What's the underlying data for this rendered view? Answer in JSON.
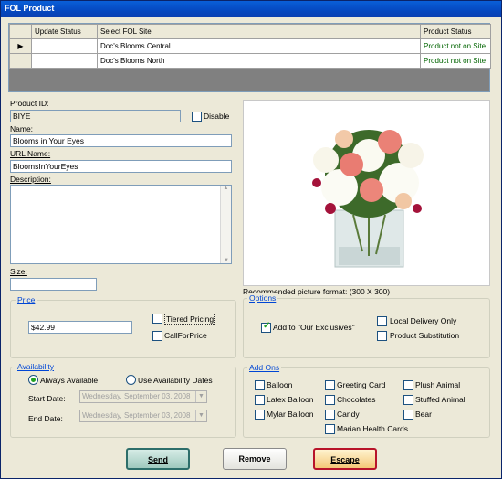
{
  "window": {
    "title": "FOL Product"
  },
  "grid": {
    "columns": [
      "Update Status",
      "Select FOL Site",
      "Product Status"
    ],
    "rows": [
      {
        "indicator": "▶",
        "update_status": "",
        "site": "Doc's Blooms Central",
        "status": "Product not on Site"
      },
      {
        "indicator": "",
        "update_status": "",
        "site": "Doc's Blooms North",
        "status": "Product not on Site"
      }
    ]
  },
  "form": {
    "product_id_label": "Product ID:",
    "product_id_value": "BIYE",
    "disable_label": "Disable",
    "name_label": "Name:",
    "name_value": "Blooms in Your Eyes",
    "url_label": "URL Name:",
    "url_value": "BloomsInYourEyes",
    "description_label": "Description:",
    "description_value": "",
    "size_label": "Size:",
    "size_value": "",
    "picture_note": "Recommended picture format: (300 X 300)"
  },
  "price": {
    "title": "Price",
    "value": "$42.99",
    "tiered_label": "Tiered Pricing",
    "callforprice_label": "CallForPrice"
  },
  "options": {
    "title": "Options",
    "exclusives_label": "Add to \"Our Exclusives\"",
    "local_delivery_label": "Local Delivery Only",
    "substitution_label": "Product Substitution"
  },
  "availability": {
    "title": "Availability",
    "always_label": "Always Available",
    "dates_label": "Use Availability Dates",
    "start_label": "Start Date:",
    "start_value": "Wednesday, September 03, 2008",
    "end_label": "End Date:",
    "end_value": "Wednesday, September 03, 2008"
  },
  "addons": {
    "title": "Add Ons",
    "items": [
      "Balloon",
      "Greeting Card",
      "Plush Animal",
      "Latex Balloon",
      "Chocolates",
      "Stuffed Animal",
      "Mylar Balloon",
      "Candy",
      "Bear",
      "Marian Health Cards"
    ]
  },
  "buttons": {
    "send": "Send",
    "remove": "Remove",
    "escape": "Escape"
  }
}
